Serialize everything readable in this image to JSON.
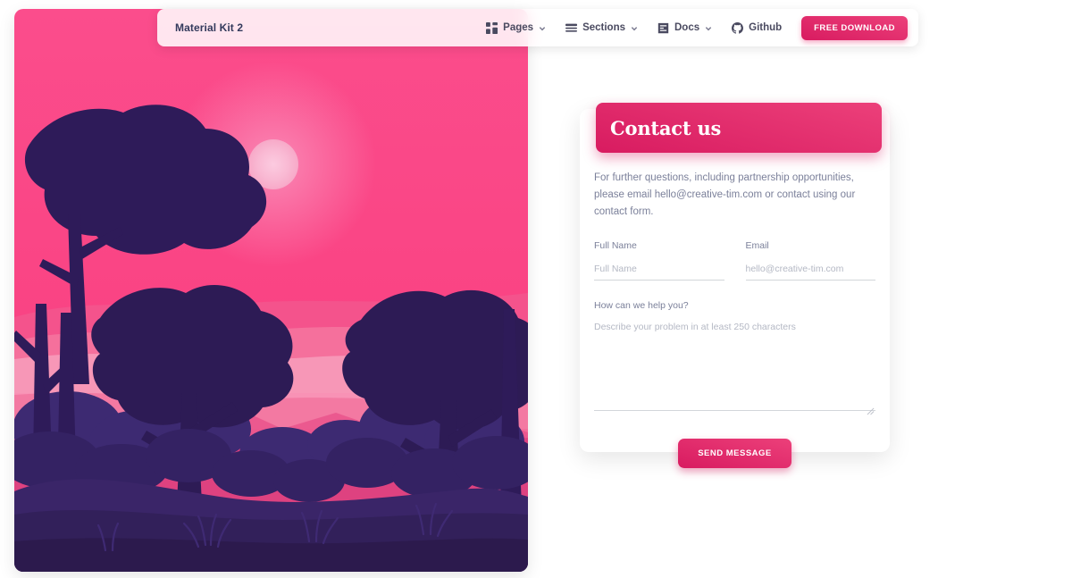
{
  "navbar": {
    "brand": "Material Kit 2",
    "items": [
      {
        "label": "Pages",
        "icon": "grid-icon",
        "has_caret": true
      },
      {
        "label": "Sections",
        "icon": "lines-icon",
        "has_caret": true
      },
      {
        "label": "Docs",
        "icon": "document-icon",
        "has_caret": true
      },
      {
        "label": "Github",
        "icon": "github-icon",
        "has_caret": false
      }
    ],
    "cta_label": "FREE DOWNLOAD"
  },
  "card": {
    "title": "Contact us",
    "lead": "For further questions, including partnership opportunities, please email hello@creative-tim.com or contact using our contact form.",
    "fields": {
      "full_name": {
        "label": "Full Name",
        "placeholder": "Full Name",
        "value": ""
      },
      "email": {
        "label": "Email",
        "placeholder": "hello@creative-tim.com",
        "value": ""
      },
      "message": {
        "label": "How can we help you?",
        "placeholder": "Describe your problem in at least 250 characters",
        "value": ""
      }
    },
    "submit_label": "SEND MESSAGE"
  },
  "illustration": {
    "name": "forest-sunset-illustration",
    "colors": {
      "sky_top": "#fa4f8b",
      "sky_mid": "#f9447f",
      "sun": "#f8b8d4",
      "hill_light": "#f48bb4",
      "hill_mid": "#ef6098",
      "hill_deep": "#e8437f",
      "trees_far": "#3b2a6b",
      "trees_near": "#2d1b55",
      "ground": "#36205f",
      "ground_dark": "#2c1a4d"
    }
  },
  "theme": {
    "accent": "#e91e63",
    "accent_dark": "#d81b60",
    "text_dark": "#333a5c",
    "text_muted": "#7b809a",
    "page_bg": "#ffffff"
  }
}
